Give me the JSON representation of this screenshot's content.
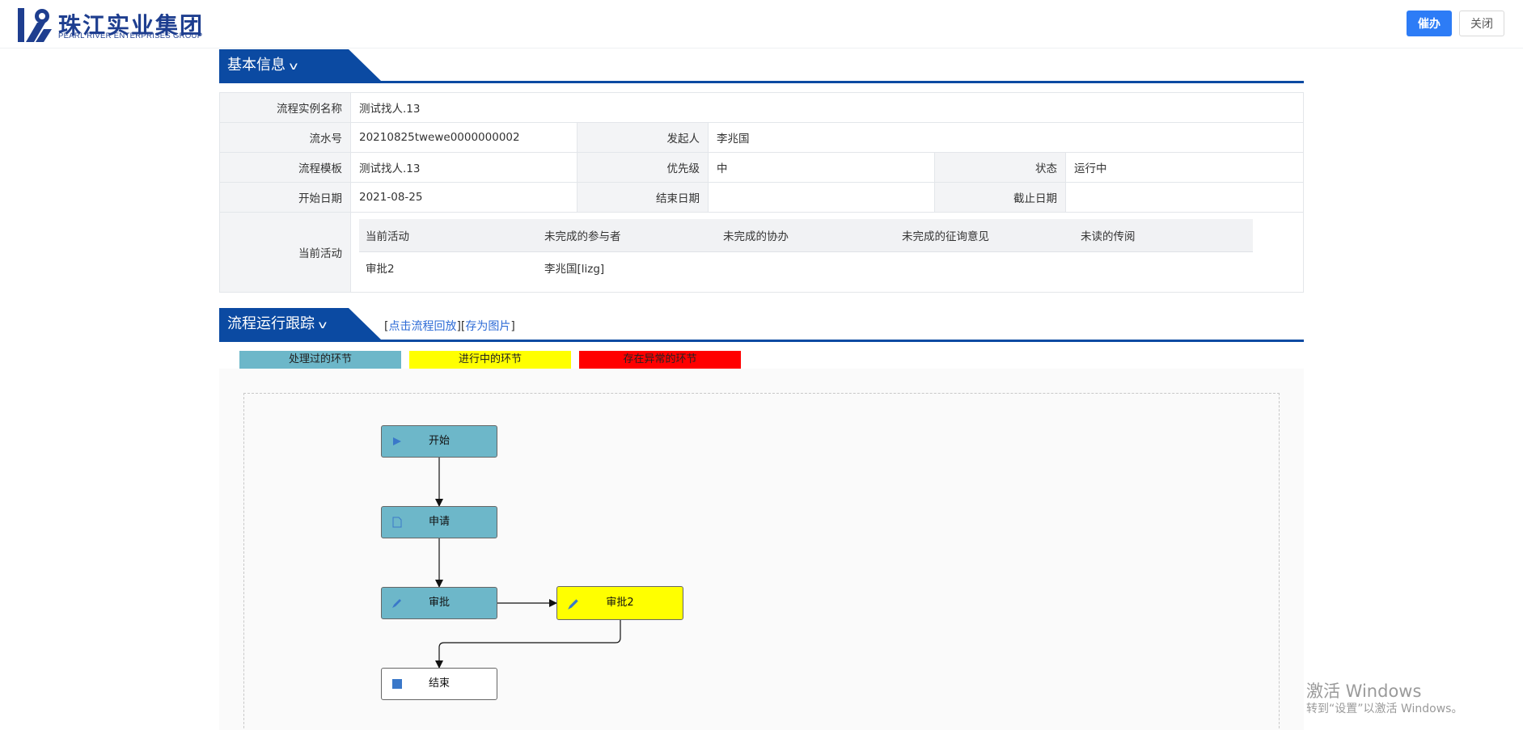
{
  "brand": {
    "name_cn": "珠江实业集团",
    "name_en": "PEARL RIVER ENTERPRISES GROUP",
    "color": "#1e3e8f"
  },
  "toolbar": {
    "urge_label": "催办",
    "close_label": "关闭"
  },
  "basic_info": {
    "section_title": "基本信息",
    "instance_name_label": "流程实例名称",
    "instance_name": "测试找人.13",
    "serial_label": "流水号",
    "serial": "20210825twewe0000000002",
    "initiator_label": "发起人",
    "initiator": "李兆国",
    "template_label": "流程模板",
    "template": "测试找人.13",
    "priority_label": "优先级",
    "priority": "中",
    "status_label": "状态",
    "status": "运行中",
    "start_date_label": "开始日期",
    "start_date": "2021-08-25",
    "end_date_label": "结束日期",
    "end_date": "",
    "deadline_label": "截止日期",
    "deadline": "",
    "current_activity_label": "当前活动",
    "activity_columns": [
      "当前活动",
      "未完成的参与者",
      "未完成的协办",
      "未完成的征询意见",
      "未读的传阅"
    ],
    "activity_rows": [
      [
        "审批2",
        "李兆国[lizg]",
        "",
        "",
        ""
      ]
    ]
  },
  "trace": {
    "section_title": "流程运行跟踪",
    "bracket_open": "[",
    "bracket_mid": "][",
    "bracket_close": "]",
    "replay_link": "点击流程回放",
    "save_image_link": "存为图片",
    "legend": [
      {
        "label": "处理过的环节",
        "color": "#6db7c9"
      },
      {
        "label": "进行中的环节",
        "color": "#ffff00"
      },
      {
        "label": "存在异常的环节",
        "color": "#ff0000"
      }
    ],
    "nodes": [
      {
        "label": "开始",
        "icon": "play-icon",
        "state": "done"
      },
      {
        "label": "申请",
        "icon": "document-icon",
        "state": "done"
      },
      {
        "label": "审批",
        "icon": "pencil-icon",
        "state": "done"
      },
      {
        "label": "审批2",
        "icon": "pencil-icon",
        "state": "active"
      },
      {
        "label": "结束",
        "icon": "stop-icon",
        "state": "plain"
      }
    ]
  },
  "os_watermark": {
    "line1": "激活 Windows",
    "line2": "转到“设置”以激活 Windows。"
  }
}
